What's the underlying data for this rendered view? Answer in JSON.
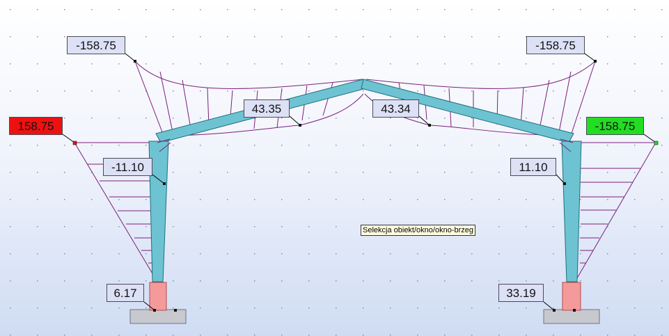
{
  "moment_labels": {
    "top_left": "-158.75",
    "top_right": "-158.75",
    "rafter_left": "43.35",
    "rafter_right": "43.34",
    "eave_left": "158.75",
    "eave_right": "-158.75",
    "column_left": "-11.10",
    "column_right": "11.10",
    "base_left": "6.17",
    "base_right": "33.19"
  },
  "tooltip": {
    "text": "Selekcja obiekt/okno/okno-brzeg"
  },
  "colors": {
    "diagram": "#7a1f7a",
    "member": "#6ec3d2",
    "extreme_max": "#ee1111",
    "extreme_min": "#22dd22",
    "foundation": "#c7c9cf",
    "column_footing": "#f59a9a"
  }
}
